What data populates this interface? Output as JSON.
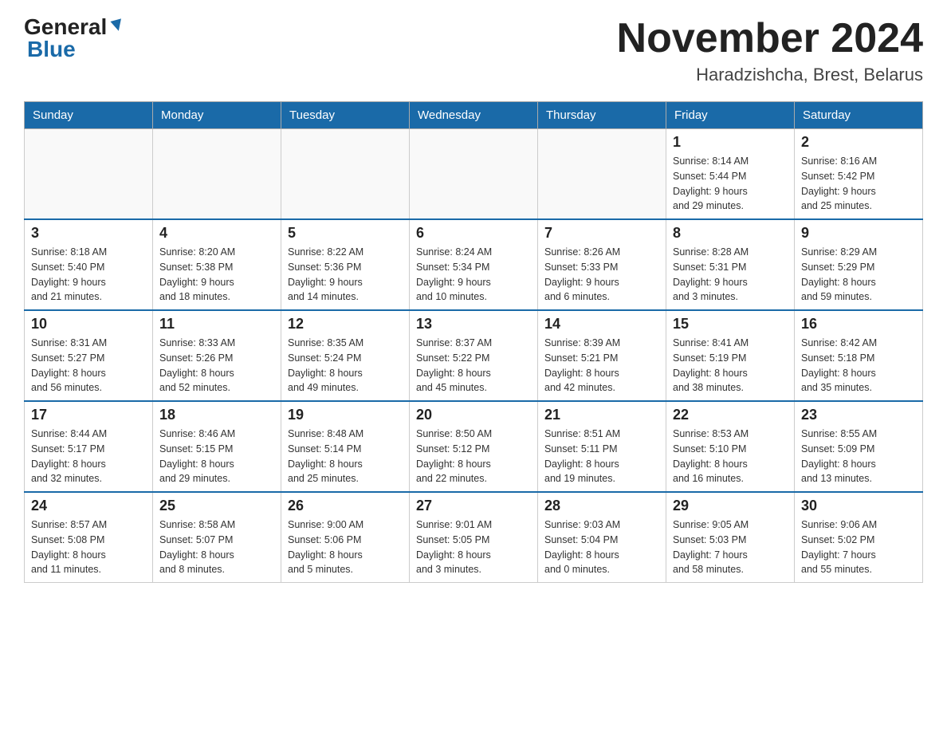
{
  "header": {
    "logo_general": "General",
    "logo_blue": "Blue",
    "main_title": "November 2024",
    "subtitle": "Haradzishcha, Brest, Belarus"
  },
  "days_of_week": [
    "Sunday",
    "Monday",
    "Tuesday",
    "Wednesday",
    "Thursday",
    "Friday",
    "Saturday"
  ],
  "weeks": [
    {
      "days": [
        {
          "date": "",
          "info": ""
        },
        {
          "date": "",
          "info": ""
        },
        {
          "date": "",
          "info": ""
        },
        {
          "date": "",
          "info": ""
        },
        {
          "date": "",
          "info": ""
        },
        {
          "date": "1",
          "info": "Sunrise: 8:14 AM\nSunset: 5:44 PM\nDaylight: 9 hours\nand 29 minutes."
        },
        {
          "date": "2",
          "info": "Sunrise: 8:16 AM\nSunset: 5:42 PM\nDaylight: 9 hours\nand 25 minutes."
        }
      ]
    },
    {
      "days": [
        {
          "date": "3",
          "info": "Sunrise: 8:18 AM\nSunset: 5:40 PM\nDaylight: 9 hours\nand 21 minutes."
        },
        {
          "date": "4",
          "info": "Sunrise: 8:20 AM\nSunset: 5:38 PM\nDaylight: 9 hours\nand 18 minutes."
        },
        {
          "date": "5",
          "info": "Sunrise: 8:22 AM\nSunset: 5:36 PM\nDaylight: 9 hours\nand 14 minutes."
        },
        {
          "date": "6",
          "info": "Sunrise: 8:24 AM\nSunset: 5:34 PM\nDaylight: 9 hours\nand 10 minutes."
        },
        {
          "date": "7",
          "info": "Sunrise: 8:26 AM\nSunset: 5:33 PM\nDaylight: 9 hours\nand 6 minutes."
        },
        {
          "date": "8",
          "info": "Sunrise: 8:28 AM\nSunset: 5:31 PM\nDaylight: 9 hours\nand 3 minutes."
        },
        {
          "date": "9",
          "info": "Sunrise: 8:29 AM\nSunset: 5:29 PM\nDaylight: 8 hours\nand 59 minutes."
        }
      ]
    },
    {
      "days": [
        {
          "date": "10",
          "info": "Sunrise: 8:31 AM\nSunset: 5:27 PM\nDaylight: 8 hours\nand 56 minutes."
        },
        {
          "date": "11",
          "info": "Sunrise: 8:33 AM\nSunset: 5:26 PM\nDaylight: 8 hours\nand 52 minutes."
        },
        {
          "date": "12",
          "info": "Sunrise: 8:35 AM\nSunset: 5:24 PM\nDaylight: 8 hours\nand 49 minutes."
        },
        {
          "date": "13",
          "info": "Sunrise: 8:37 AM\nSunset: 5:22 PM\nDaylight: 8 hours\nand 45 minutes."
        },
        {
          "date": "14",
          "info": "Sunrise: 8:39 AM\nSunset: 5:21 PM\nDaylight: 8 hours\nand 42 minutes."
        },
        {
          "date": "15",
          "info": "Sunrise: 8:41 AM\nSunset: 5:19 PM\nDaylight: 8 hours\nand 38 minutes."
        },
        {
          "date": "16",
          "info": "Sunrise: 8:42 AM\nSunset: 5:18 PM\nDaylight: 8 hours\nand 35 minutes."
        }
      ]
    },
    {
      "days": [
        {
          "date": "17",
          "info": "Sunrise: 8:44 AM\nSunset: 5:17 PM\nDaylight: 8 hours\nand 32 minutes."
        },
        {
          "date": "18",
          "info": "Sunrise: 8:46 AM\nSunset: 5:15 PM\nDaylight: 8 hours\nand 29 minutes."
        },
        {
          "date": "19",
          "info": "Sunrise: 8:48 AM\nSunset: 5:14 PM\nDaylight: 8 hours\nand 25 minutes."
        },
        {
          "date": "20",
          "info": "Sunrise: 8:50 AM\nSunset: 5:12 PM\nDaylight: 8 hours\nand 22 minutes."
        },
        {
          "date": "21",
          "info": "Sunrise: 8:51 AM\nSunset: 5:11 PM\nDaylight: 8 hours\nand 19 minutes."
        },
        {
          "date": "22",
          "info": "Sunrise: 8:53 AM\nSunset: 5:10 PM\nDaylight: 8 hours\nand 16 minutes."
        },
        {
          "date": "23",
          "info": "Sunrise: 8:55 AM\nSunset: 5:09 PM\nDaylight: 8 hours\nand 13 minutes."
        }
      ]
    },
    {
      "days": [
        {
          "date": "24",
          "info": "Sunrise: 8:57 AM\nSunset: 5:08 PM\nDaylight: 8 hours\nand 11 minutes."
        },
        {
          "date": "25",
          "info": "Sunrise: 8:58 AM\nSunset: 5:07 PM\nDaylight: 8 hours\nand 8 minutes."
        },
        {
          "date": "26",
          "info": "Sunrise: 9:00 AM\nSunset: 5:06 PM\nDaylight: 8 hours\nand 5 minutes."
        },
        {
          "date": "27",
          "info": "Sunrise: 9:01 AM\nSunset: 5:05 PM\nDaylight: 8 hours\nand 3 minutes."
        },
        {
          "date": "28",
          "info": "Sunrise: 9:03 AM\nSunset: 5:04 PM\nDaylight: 8 hours\nand 0 minutes."
        },
        {
          "date": "29",
          "info": "Sunrise: 9:05 AM\nSunset: 5:03 PM\nDaylight: 7 hours\nand 58 minutes."
        },
        {
          "date": "30",
          "info": "Sunrise: 9:06 AM\nSunset: 5:02 PM\nDaylight: 7 hours\nand 55 minutes."
        }
      ]
    }
  ]
}
